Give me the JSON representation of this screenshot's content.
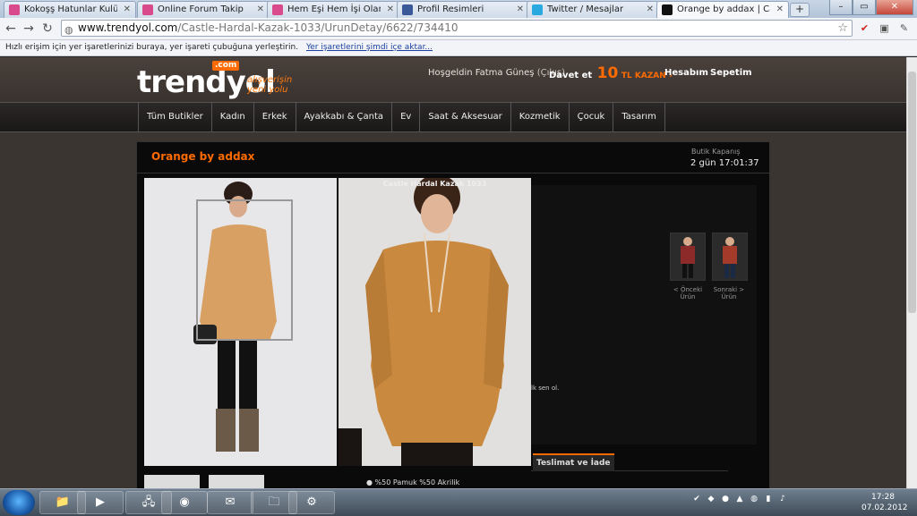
{
  "tabs": [
    {
      "title": "Kokoşş Hatunlar Kulübü - S",
      "favicon": "pink-page-icon",
      "color": "#d94a8c"
    },
    {
      "title": "Online Forum Takip",
      "favicon": "pink-page-icon",
      "color": "#d94a8c"
    },
    {
      "title": "Hem Eşi Hem İşi Olan Baya",
      "favicon": "pink-page-icon",
      "color": "#d94a8c"
    },
    {
      "title": "Profil Resimleri",
      "favicon": "facebook-icon",
      "color": "#3b5998"
    },
    {
      "title": "Twitter / Mesajlar",
      "favicon": "twitter-icon",
      "color": "#2aa9e0"
    },
    {
      "title": "Orange by addax | Castle H",
      "favicon": "trendyol-icon",
      "color": "#111111"
    }
  ],
  "address": {
    "host": "www.trendyol.com",
    "path": "/Castle-Hardal-Kazak-1033/UrunDetay/6622/734410"
  },
  "bookmarks_bar": {
    "text": "Hızlı erişim için yer işaretlerinizi buraya, yer işareti çubuğuna yerleştirin.",
    "link": "Yer işaretlerini şimdi içe aktar..."
  },
  "header": {
    "logo": "trendyol",
    "logo_badge": ".com",
    "slogan_line1": "alışverişin",
    "slogan_line2": "yeni yolu",
    "welcome": "Hoşgeldin Fatma Güneş",
    "logout": "(Çıkış)",
    "davet": "Davet et",
    "davet_number": "10",
    "davet_kazan": "TL KAZAN",
    "davet_arrow": "›",
    "account": "Hesabım",
    "cart": "Sepetim"
  },
  "menu": [
    "Tüm Butikler",
    "Kadın",
    "Erkek",
    "Ayakkabı & Çanta",
    "Ev",
    "Saat & Aksesuar",
    "Kozmetik",
    "Çocuk",
    "Tasarım"
  ],
  "boutique": {
    "title": "Orange by addax",
    "close_label": "Butik Kapanış",
    "close_time": "2 gün 17:01:37",
    "product_caption": "Castle Hardal Kazak 1033",
    "prev_label": "< Önceki Ürün",
    "next_label": "Sonraki > Ürün",
    "snippet": "lk sen ol.",
    "tab_label": "Teslimat ve İade",
    "material": "%50 Pamuk %50 Akrilik"
  },
  "taskbar": {
    "time": "17:28",
    "date": "07.02.2012"
  }
}
